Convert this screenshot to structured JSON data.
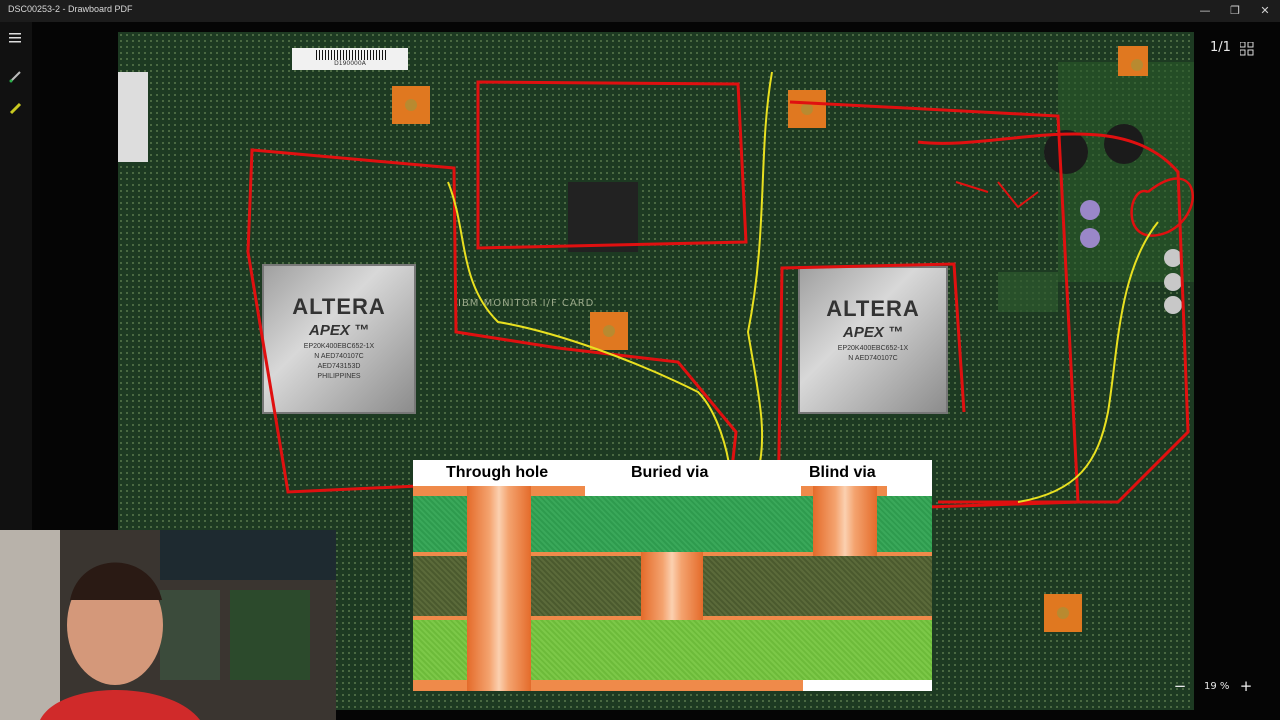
{
  "window": {
    "title": "DSC00253-2 - Drawboard PDF"
  },
  "controls": {
    "minimize": "—",
    "restore": "❐",
    "close": "✕"
  },
  "toolbar": {
    "menu_icon": "hamburger-menu-icon",
    "pen_icon": "pen-icon",
    "highlighter_icon": "highlighter-icon"
  },
  "viewer": {
    "page_indicator": "1/1",
    "zoom_level": "19 %",
    "zoom_out": "−",
    "zoom_in": "+"
  },
  "photo": {
    "sticker_code": "D190000A",
    "silk_text": "IBM MONITOR I/F CARD",
    "chips": [
      {
        "brand": "ALTERA",
        "series": "APEX ™",
        "lines": [
          "EP20K400EBC652-1X",
          "N AED740107C",
          "AED743153D",
          "PHILIPPINES"
        ]
      },
      {
        "brand": "ALTERA",
        "series": "APEX ™",
        "lines": [
          "EP20K400EBC652-1X",
          "N AED740107C"
        ]
      }
    ]
  },
  "diagram": {
    "labels": {
      "through": "Through hole",
      "buried": "Buried via",
      "blind": "Blind via"
    },
    "colors": {
      "copper": "#ef8a4a",
      "top_layer": "#2e9b4e",
      "mid_layer": "#4b5a2e",
      "bottom_layer": "#6dbb3a"
    }
  }
}
